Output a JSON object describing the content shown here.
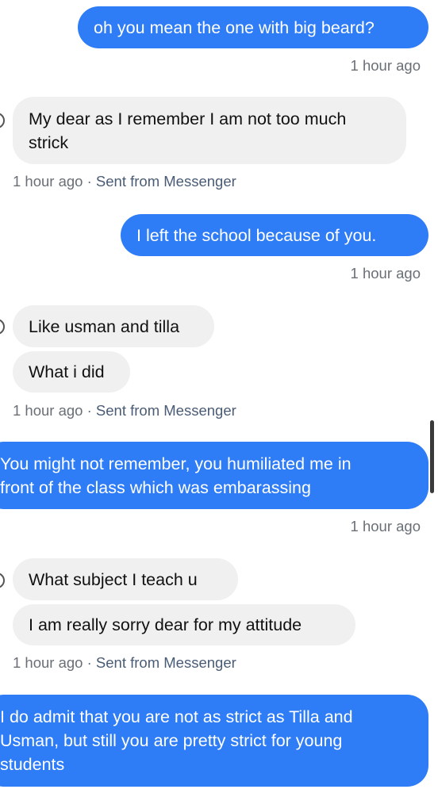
{
  "messages": [
    {
      "dir": "out",
      "text": "oh you mean the one with big beard?",
      "time": "1 hour ago"
    },
    {
      "dir": "in",
      "text": "My dear as I remember I am not too much\nstrick",
      "time": "1 hour ago",
      "source": "Sent from Messenger"
    },
    {
      "dir": "out",
      "text": "I left the school because of you.",
      "time": "1 hour ago"
    },
    {
      "dir": "in",
      "text": "Like usman and tilla"
    },
    {
      "dir": "in",
      "text": "What i did",
      "time": "1 hour ago",
      "source": "Sent from Messenger"
    },
    {
      "dir": "out",
      "text": "You might not remember, you humiliated me in\nfront of the class which was embarassing",
      "time": "1 hour ago"
    },
    {
      "dir": "in",
      "text": "What subject I teach u"
    },
    {
      "dir": "in",
      "text": "I am really sorry dear for my attitude",
      "time": "1 hour ago",
      "source": "Sent from Messenger"
    },
    {
      "dir": "out",
      "text": "I do admit that you are not as strict as Tilla and\nUsman, but still you are pretty strict for young\nstudents"
    }
  ],
  "separator": " · "
}
